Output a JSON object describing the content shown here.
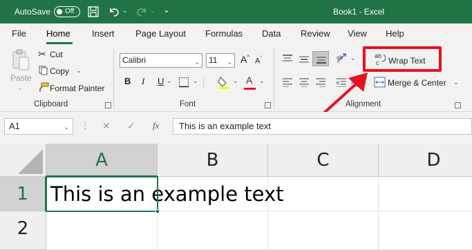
{
  "titlebar": {
    "autosave_label": "AutoSave",
    "autosave_state": "Off",
    "title": "Book1  -  Excel",
    "bg_color": "#217346"
  },
  "menu": {
    "tabs": [
      "File",
      "Home",
      "Insert",
      "Page Layout",
      "Formulas",
      "Data",
      "Review",
      "View",
      "Help"
    ],
    "active": "Home"
  },
  "clipboard": {
    "paste": "Paste",
    "cut": "Cut",
    "copy": "Copy",
    "format_painter": "Format Painter",
    "group_label": "Clipboard"
  },
  "font": {
    "name": "Calibri",
    "size": "11",
    "bold": "B",
    "italic": "I",
    "underline": "U",
    "font_color_glyph": "A",
    "group_label": "Font",
    "highlight_color": "#ffff00",
    "font_color": "#e81123"
  },
  "alignment": {
    "wrap_text": "Wrap Text",
    "merge_center": "Merge & Center",
    "group_label": "Alignment"
  },
  "annotation": {
    "color": "#e81123"
  },
  "formula_bar": {
    "name_box": "A1",
    "fx": "fx",
    "content": "This is an example text"
  },
  "grid": {
    "columns": [
      "A",
      "B",
      "C",
      "D"
    ],
    "rows": [
      "1",
      "2"
    ],
    "selected_cell": "A1",
    "cell_a1": "This is an example text"
  }
}
